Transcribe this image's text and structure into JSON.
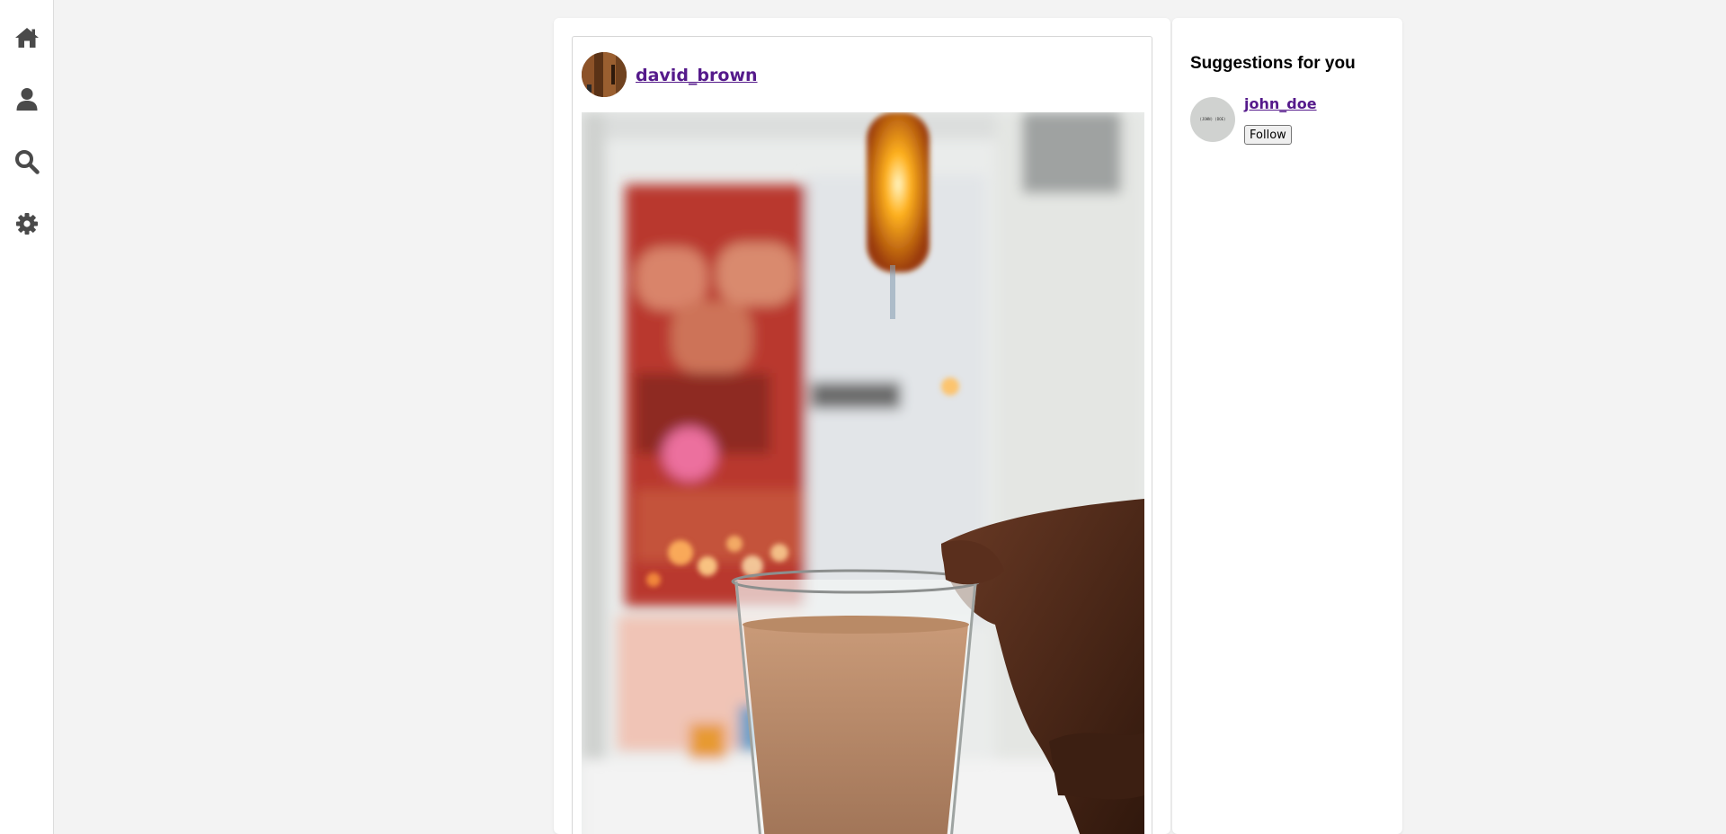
{
  "sidebar": {
    "items": [
      {
        "icon": "home-icon"
      },
      {
        "icon": "user-icon"
      },
      {
        "icon": "search-icon"
      },
      {
        "icon": "gear-icon"
      }
    ],
    "icon_color": "#4a4a4a"
  },
  "post": {
    "username": "david_brown"
  },
  "suggestions": {
    "title": "Suggestions for you",
    "items": [
      {
        "username": "john_doe",
        "avatar_text": "(JOHN) (DOE)",
        "follow_label": "Follow"
      }
    ]
  },
  "colors": {
    "link": "#551a8b",
    "background": "#f3f3f3",
    "panel": "#ffffff"
  }
}
